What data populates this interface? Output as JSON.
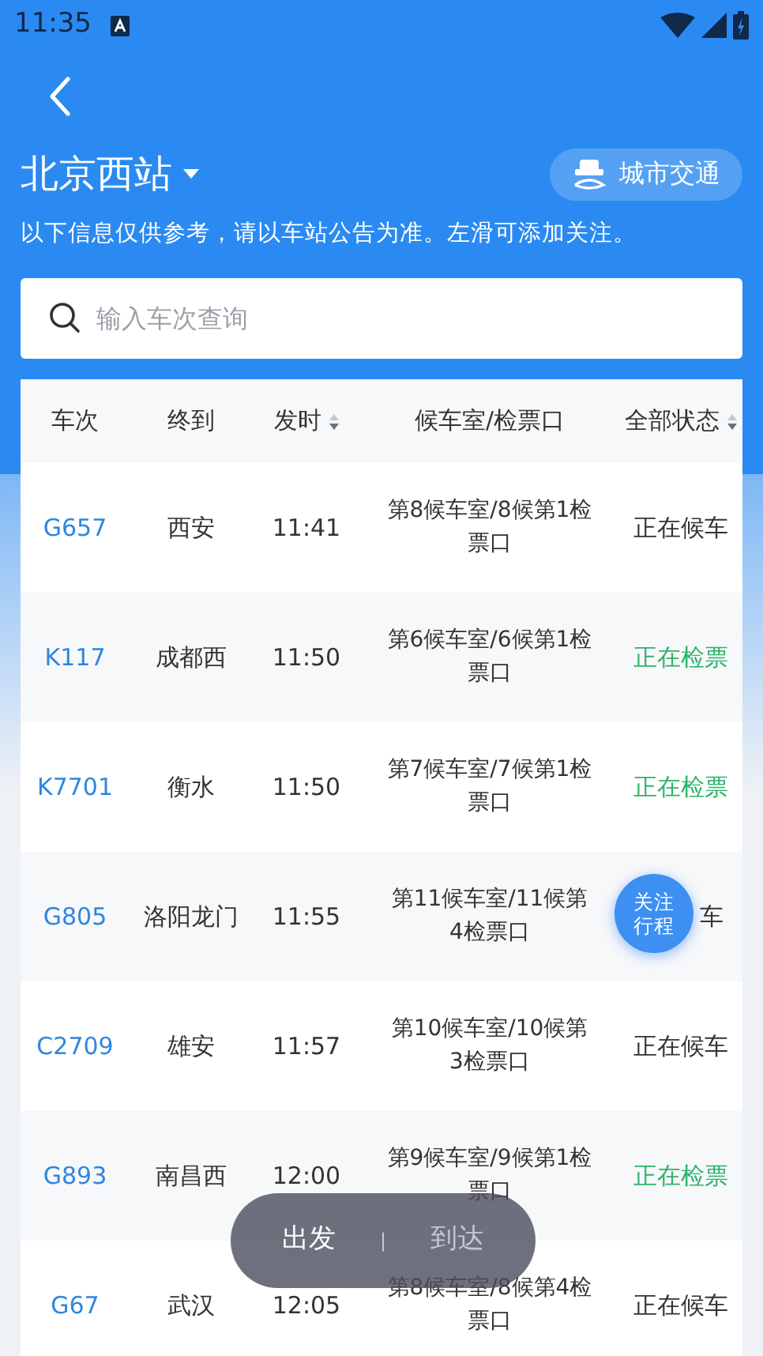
{
  "status_bar": {
    "time": "11:35"
  },
  "header": {
    "station": "北京西站",
    "city_transit_button": "城市交通",
    "notice": "以下信息仅供参考，请以车站公告为准。左滑可添加关注。"
  },
  "search": {
    "placeholder": "输入车次查询"
  },
  "table": {
    "columns": [
      {
        "label": "车次",
        "sortable": false
      },
      {
        "label": "终到",
        "sortable": false
      },
      {
        "label": "发时",
        "sortable": true
      },
      {
        "label": "候车室/检票口",
        "sortable": false
      },
      {
        "label": "全部状态",
        "sortable": true
      }
    ],
    "rows": [
      {
        "train": "G657",
        "destination": "西安",
        "departs": "11:41",
        "gate": "第8候车室/8候第1检票口",
        "status": "正在候车",
        "kind": "waiting"
      },
      {
        "train": "K117",
        "destination": "成都西",
        "departs": "11:50",
        "gate": "第6候车室/6候第1检票口",
        "status": "正在检票",
        "kind": "checking"
      },
      {
        "train": "K7701",
        "destination": "衡水",
        "departs": "11:50",
        "gate": "第7候车室/7候第1检票口",
        "status": "正在检票",
        "kind": "checking"
      },
      {
        "train": "G805",
        "destination": "洛阳龙门",
        "departs": "11:55",
        "gate": "第11候车室/11候第4检票口",
        "status": "车",
        "kind": "waiting",
        "follow_button": "关注行程"
      },
      {
        "train": "C2709",
        "destination": "雄安",
        "departs": "11:57",
        "gate": "第10候车室/10候第3检票口",
        "status": "正在候车",
        "kind": "waiting"
      },
      {
        "train": "G893",
        "destination": "南昌西",
        "departs": "12:00",
        "gate": "第9候车室/9候第1检票口",
        "status": "正在检票",
        "kind": "checking"
      },
      {
        "train": "G67",
        "destination": "武汉",
        "departs": "12:05",
        "gate": "第8候车室/8候第4检票口",
        "status": "正在候车",
        "kind": "waiting"
      }
    ]
  },
  "toggle": [
    {
      "label": "出发",
      "selected": true
    },
    {
      "label": "到达",
      "selected": false
    }
  ],
  "toggle_separator": "|"
}
